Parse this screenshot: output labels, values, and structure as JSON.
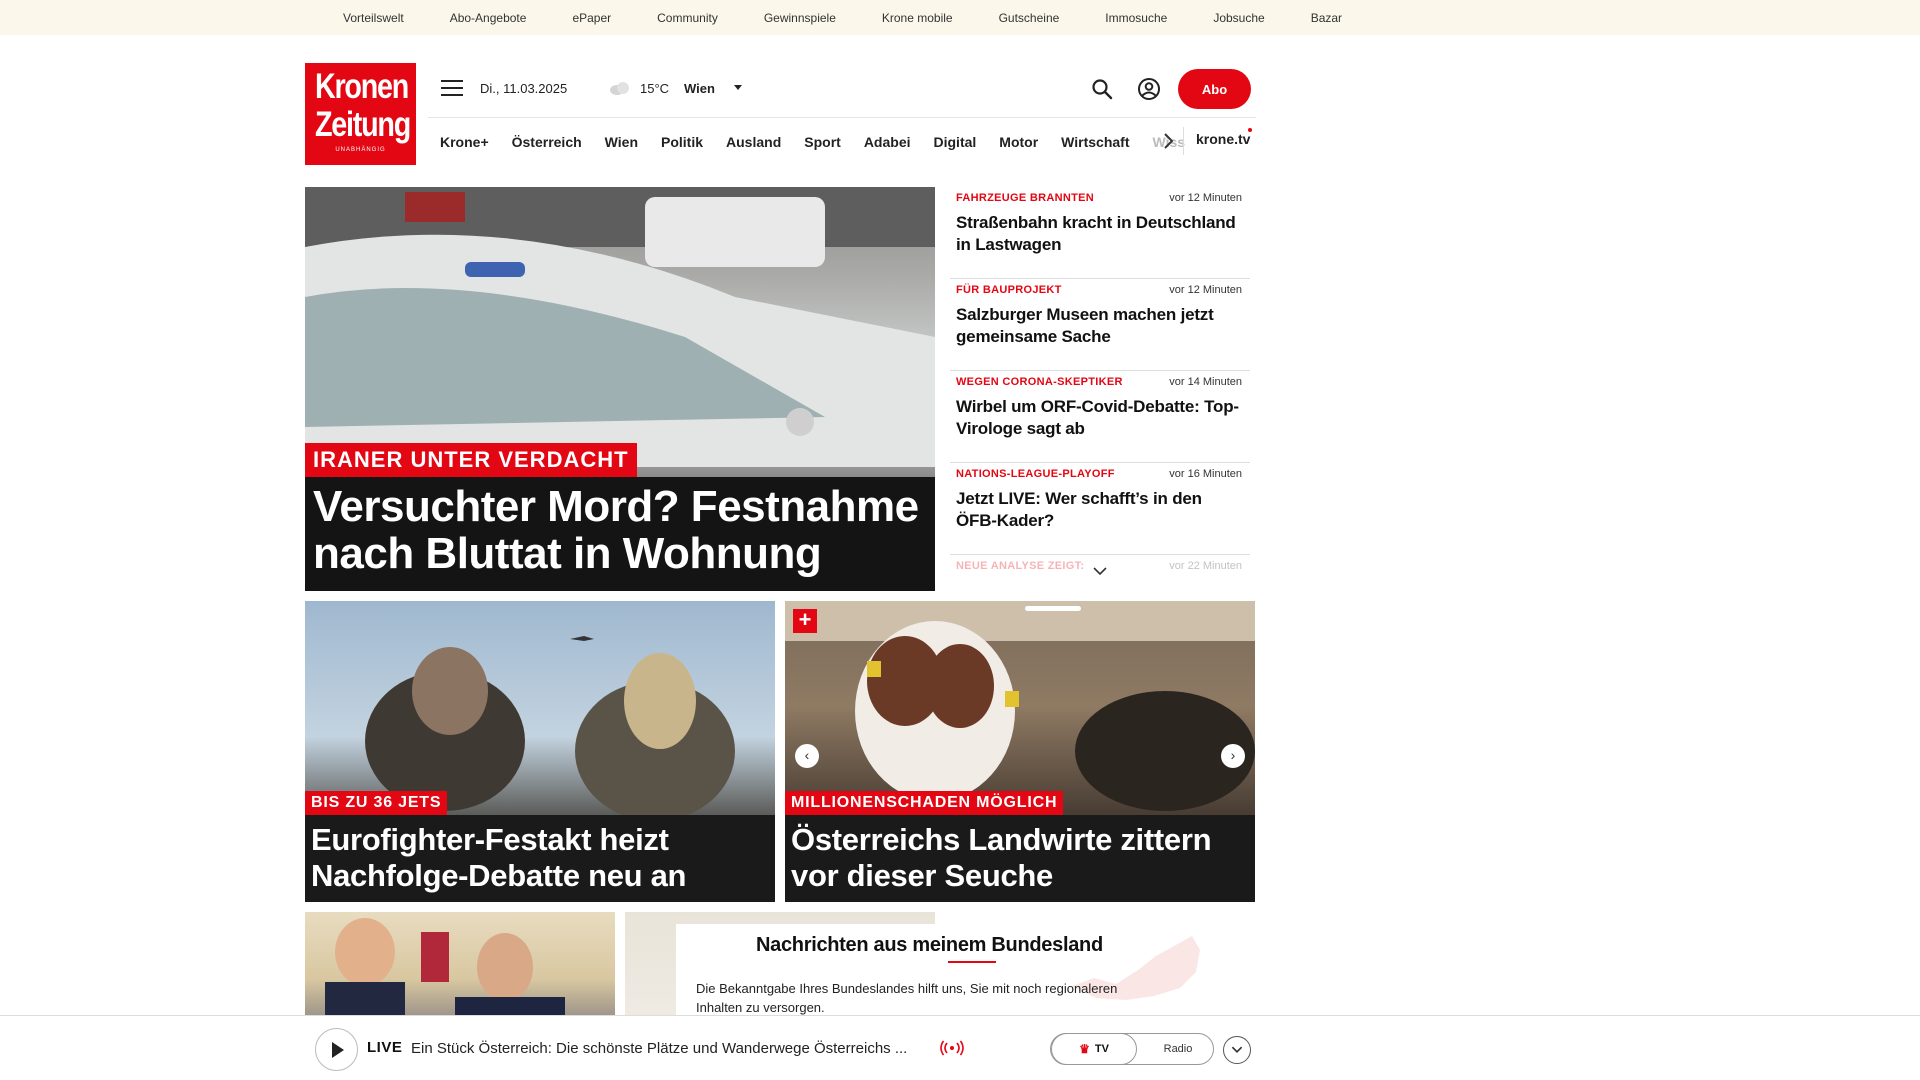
{
  "topbar": {
    "links": [
      "Vorteilswelt",
      "Abo-Angebote",
      "ePaper",
      "Community",
      "Gewinnspiele",
      "Krone mobile",
      "Gutscheine",
      "Immosuche",
      "Jobsuche",
      "Bazar"
    ]
  },
  "header": {
    "logo": {
      "line1": "Kronen",
      "line2": "Zeitung",
      "line3": "UNABHÄNGIG"
    },
    "date": "Di., 11.03.2025",
    "temperature": "15°C",
    "city": "Wien",
    "abo_label": "Abo",
    "icons": {
      "menu": "hamburger-menu-icon",
      "weather": "cloud-icon",
      "search": "search-icon",
      "user": "user-account-icon"
    }
  },
  "nav": {
    "items": [
      "Krone+",
      "Österreich",
      "Wien",
      "Politik",
      "Ausland",
      "Sport",
      "Adabei",
      "Digital",
      "Motor",
      "Wirtschaft",
      "Wiss"
    ],
    "tv_link": "krone.tv"
  },
  "hero": {
    "kicker": "IRANER UNTER VERDACHT",
    "headline": "Versuchter Mord? Festnahme nach Bluttat in Wohnung"
  },
  "ticker": [
    {
      "kicker": "FAHRZEUGE BRANNTEN",
      "time": "vor 12 Minuten",
      "title": "Straßenbahn kracht in Deutschland in Lastwagen"
    },
    {
      "kicker": "FÜR BAUPROJEKT",
      "time": "vor 12 Minuten",
      "title": "Salzburger Museen machen jetzt gemeinsame Sache"
    },
    {
      "kicker": "WEGEN CORONA-SKEPTIKER",
      "time": "vor 14 Minuten",
      "title": "Wirbel um ORF-Covid-Debatte: Top-Virologe sagt ab"
    },
    {
      "kicker": "NATIONS-LEAGUE-PLAYOFF",
      "time": "vor 16 Minuten",
      "title": "Jetzt LIVE: Wer schafft’s in den ÖFB-Kader?"
    },
    {
      "kicker": "NEUE ANALYSE ZEIGT:",
      "time": "vor 22 Minuten",
      "title": ""
    }
  ],
  "teasers": [
    {
      "kicker": "BIS ZU 36 JETS",
      "headline": "Eurofighter-Festakt heizt Nachfolge-Debatte neu an"
    },
    {
      "kicker": "MILLIONENSCHADEN MÖGLICH",
      "headline": "Österreichs Landwirte zittern vor dieser Seuche",
      "plus": "+"
    }
  ],
  "bundesland": {
    "title": "Nachrichten aus meinem Bundesland",
    "text": "Die Bekanntgabe Ihres Bundeslandes hilft uns, Sie mit noch regionaleren Inhalten zu versorgen."
  },
  "livebar": {
    "live_label": "LIVE",
    "text": "Ein Stück Österreich: Die schönste Plätze und Wanderwege Österreichs ...",
    "tv_label": "TV",
    "radio_label": "Radio"
  },
  "colors": {
    "brand_red": "#e30613",
    "topbar_bg": "#fbf7ea"
  }
}
